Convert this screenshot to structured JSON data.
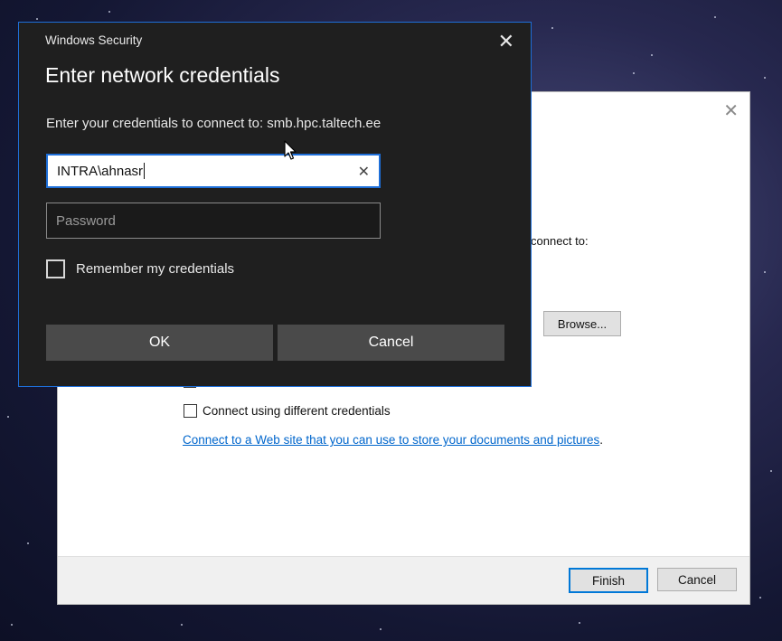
{
  "security_dialog": {
    "title": "Windows Security",
    "heading": "Enter network credentials",
    "description": "Enter your credentials to connect to: smb.hpc.taltech.ee",
    "username_value": "INTRA\\ahnasr",
    "password_placeholder": "Password",
    "remember_label": "Remember my credentials",
    "ok_label": "OK",
    "cancel_label": "Cancel",
    "close_glyph": "✕",
    "clear_glyph": "✕",
    "accent": "#1e6fd9"
  },
  "wizard": {
    "close_glyph": "✕",
    "connect_text": "connect to:",
    "browse_label": "Browse...",
    "different_credentials_label": "Connect using different credentials",
    "web_link_text": "Connect to a Web site that you can use to store your documents and pictures",
    "web_link_trailing": ".",
    "finish_label": "Finish",
    "cancel_label": "Cancel"
  },
  "icons": [
    "close-icon",
    "clear-input-icon",
    "checkbox-icon",
    "mouse-pointer-icon"
  ]
}
